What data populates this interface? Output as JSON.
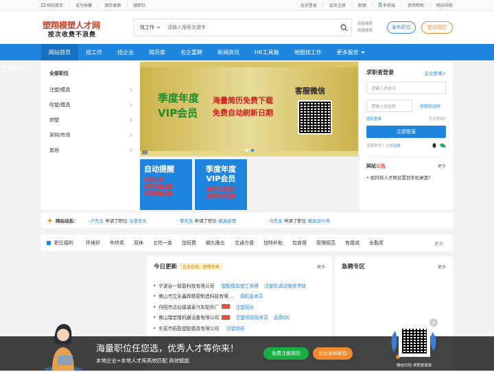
{
  "topbar": {
    "left": [
      "网站首页",
      "设为收藏",
      "保存桌面",
      "搜职位"
    ],
    "right": [
      "会员登录",
      "会员注册",
      "职顿",
      "手机端",
      "使用帮助",
      "网站导航"
    ]
  },
  "header": {
    "logo_title": "塑翔模塑人才网",
    "logo_slogan": "按次收费不浪费",
    "search_type": "找工作",
    "search_placeholder": "请输入搜索关键字",
    "quick1": "高级搜索",
    "quick2": "地图搜索",
    "btn_publish": "发布职位",
    "btn_register": "登记简历"
  },
  "nav": {
    "items": [
      "网站首页",
      "找工作",
      "找企业",
      "简历库",
      "名企嘉聘",
      "新闻资讯",
      "HR工具箱",
      "地图找工作",
      "更多服务"
    ],
    "mgmt": "管理中心"
  },
  "categories": {
    "title": "全部职位",
    "items": [
      "注塑/模具",
      "吹塑/模具",
      "挤塑",
      "采购/市场",
      "其他"
    ]
  },
  "banner": {
    "vip": "季度年度\nVIP会员",
    "line1": "海量简历免费下载",
    "line2": "免费自动刷新日期",
    "kefu": "客服微信"
  },
  "small_banners": [
    {
      "head": "自动提醒",
      "sub": "简历投递\n简历更新提醒\n简历刷新提醒"
    },
    {
      "head": "季度年度\nVIP会员",
      "sub": "免费下载简历\n免费刷新日期"
    }
  ],
  "login": {
    "title": "求职者登录",
    "company_link": "企业登录>",
    "phone_placeholder": "请输入手机号",
    "code_placeholder": "请输入验证码",
    "get_code": "获取验证码",
    "pwd_login": "密码登录",
    "forgot": "忘记密码?",
    "submit": "立即登录",
    "no_account": "没有账号？立即",
    "register": "注册",
    "notice_a": "网站",
    "notice_b": "公告",
    "notice_more": "更多",
    "notice_item": "如何将人才网设置到手机桌面？"
  },
  "dynamics": {
    "label": "网站动态：",
    "entries": [
      {
        "name": "卢先生",
        "act": "申请了职位",
        "job": "注塑班长"
      },
      {
        "name": "黎先生",
        "act": "申请了职位",
        "job": "模具经理"
      },
      {
        "name": "马先生",
        "act": "申请了职位",
        "job": "模具设计师"
      }
    ]
  },
  "welfare": {
    "label": "职位福利",
    "tags": [
      "环境好",
      "年终奖",
      "双休",
      "五险一金",
      "加班费",
      "朝九晚五",
      "交通方便",
      "加特补助",
      "包食宿",
      "管理规范",
      "有提成",
      "全勤奖"
    ],
    "more": "更多"
  },
  "today": {
    "title": "今日更新",
    "badge": "企业在线，职等你来",
    "more": "更多",
    "rows": [
      {
        "company": "宁波谷一智能科技有限公司",
        "jobs": [
          "塑胶模具钳工师傅",
          "注塑机调试维修学徒"
        ],
        "flag": false
      },
      {
        "company": "佛山市艾永鑫辉精密制造科技有限...",
        "jobs": [
          "调机技术员"
        ],
        "flag": false
      },
      {
        "company": "丹阳市访仙镇诚泰汽车配件厂",
        "jobs": [
          "注塑班长"
        ],
        "flag": true
      },
      {
        "company": "佛山瑞宏隆机器设备有限公司",
        "jobs": [
          "注塑领班技术员",
          "品质QC"
        ],
        "flag": true
      },
      {
        "company": "东莞市拓盈塑胶模具有限公司",
        "jobs": [
          "注塑领班"
        ],
        "flag": false
      },
      {
        "company": "",
        "jobs": [],
        "flag": false
      },
      {
        "company": "",
        "jobs": [],
        "flag": false
      },
      {
        "company": "",
        "jobs": [],
        "flag": false
      }
    ]
  },
  "urgent": {
    "title": "急聘专区",
    "more": "更多"
  },
  "overlay": {
    "line1": "海量职位任您选，优秀人才等你来！",
    "line2": "本地企业+本地人才库高效匹配 高效赋能",
    "btn1": "免费注册简历",
    "btn2": "企业发布职位",
    "qr_caption": "微信扫码 求职更简单",
    "close": "×"
  }
}
